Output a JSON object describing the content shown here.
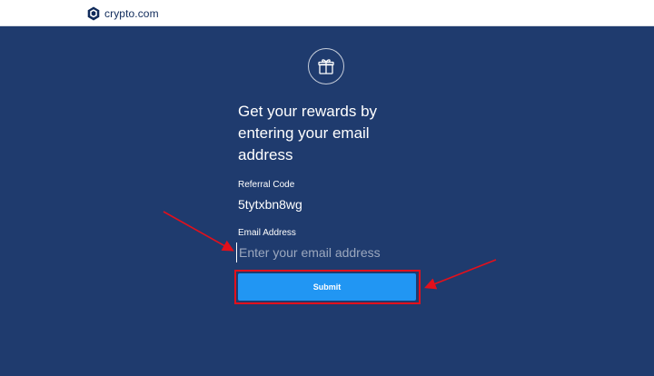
{
  "header": {
    "logo_text": "crypto.com",
    "logo_icon": "crypto-lion-shield-icon"
  },
  "form": {
    "gift_icon": "gift-icon",
    "heading": "Get your rewards by entering your email address",
    "referral_label": "Referral Code",
    "referral_value": "5tytxbn8wg",
    "email_label": "Email Address",
    "email_placeholder": "Enter your email address",
    "email_value": "",
    "submit_label": "Submit"
  },
  "annotations": {
    "arrow_color": "#e3101b",
    "highlight_color": "#e3101b"
  },
  "colors": {
    "background": "#1f3b6e",
    "button": "#2196f3",
    "header": "#ffffff"
  }
}
